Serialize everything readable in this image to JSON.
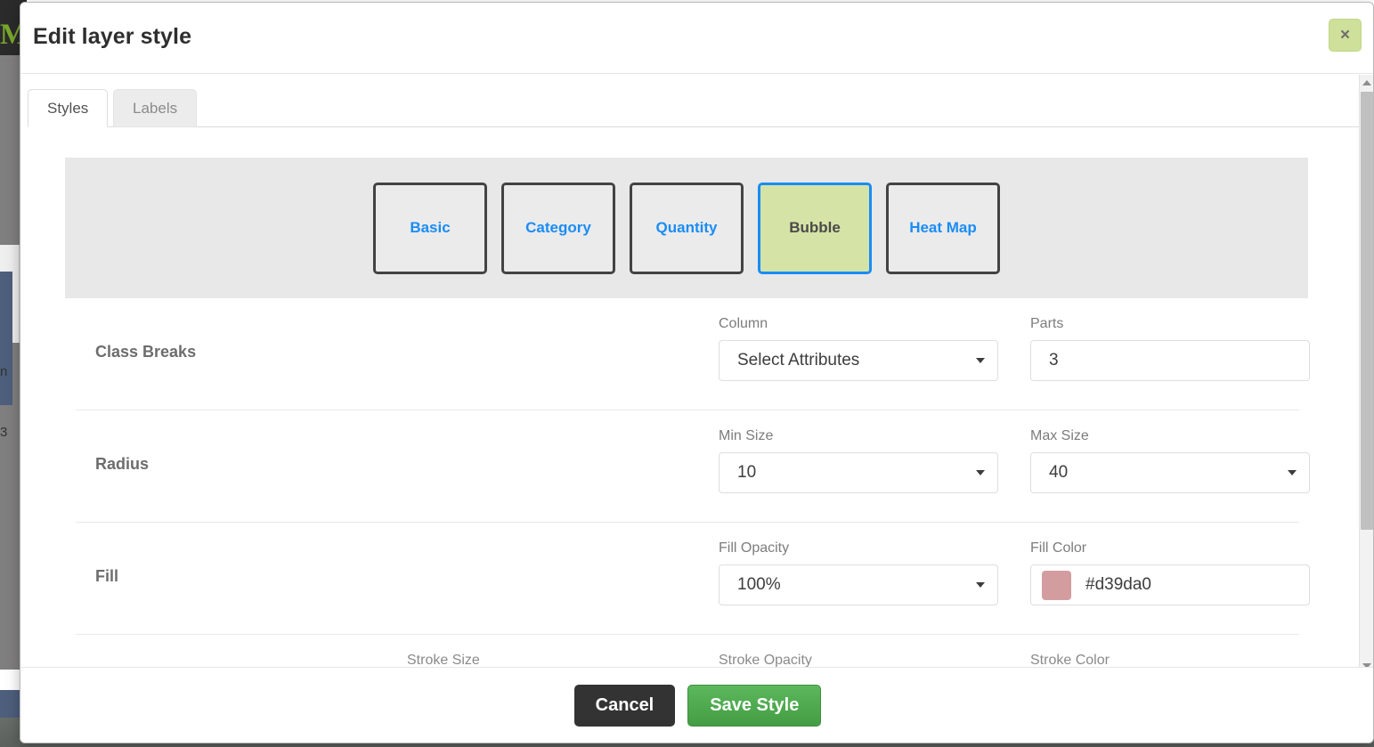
{
  "background": {
    "logo_text": "M",
    "snippet_a": "n",
    "snippet_b": "3"
  },
  "modal": {
    "title": "Edit layer style",
    "close_icon": "close-icon",
    "close_label": "×",
    "tabs": [
      {
        "label": "Styles",
        "active": true
      },
      {
        "label": "Labels",
        "active": false
      }
    ],
    "style_types": [
      {
        "label": "Basic",
        "selected": false
      },
      {
        "label": "Category",
        "selected": false
      },
      {
        "label": "Quantity",
        "selected": false
      },
      {
        "label": "Bubble",
        "selected": true
      },
      {
        "label": "Heat Map",
        "selected": false
      }
    ],
    "selected_style_type": "Bubble",
    "rows": {
      "class_breaks": {
        "section_label": "Class Breaks",
        "column": {
          "label": "Column",
          "value": "Select Attributes",
          "control": "select"
        },
        "parts": {
          "label": "Parts",
          "value": "3",
          "control": "input"
        }
      },
      "radius": {
        "section_label": "Radius",
        "min_size": {
          "label": "Min Size",
          "value": "10",
          "control": "select"
        },
        "max_size": {
          "label": "Max Size",
          "value": "40",
          "control": "select"
        }
      },
      "fill": {
        "section_label": "Fill",
        "fill_opacity": {
          "label": "Fill Opacity",
          "value": "100%",
          "control": "select"
        },
        "fill_color": {
          "label": "Fill Color",
          "value": "#d39da0",
          "swatch": "#d39da0",
          "control": "color"
        }
      },
      "stroke": {
        "stroke_size": {
          "label": "Stroke Size"
        },
        "stroke_opacity": {
          "label": "Stroke Opacity"
        },
        "stroke_color": {
          "label": "Stroke Color"
        }
      }
    },
    "footer": {
      "cancel_label": "Cancel",
      "save_label": "Save Style"
    }
  },
  "colors": {
    "accent_blue": "#1a8cf5",
    "selected_green": "#d5e3a6",
    "close_green": "#cfe09a",
    "save_green": "#5cb85c",
    "cancel_dark": "#333333",
    "fill_color": "#d39da0"
  }
}
